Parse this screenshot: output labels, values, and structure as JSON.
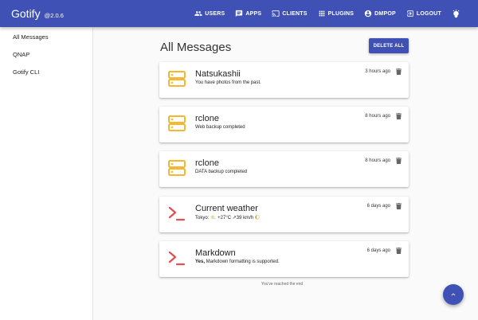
{
  "app": {
    "name": "Gotify",
    "version": "@2.0.6"
  },
  "nav": {
    "users": "USERS",
    "apps": "APPS",
    "clients": "CLIENTS",
    "plugins": "PLUGINS",
    "user": "DMPOP",
    "logout": "LOGOUT"
  },
  "sidebar": {
    "items": [
      {
        "label": "All Messages"
      },
      {
        "label": "QNAP"
      },
      {
        "label": "Gotify CLI"
      }
    ]
  },
  "main": {
    "title": "All Messages",
    "delete_all_label": "DELETE ALL",
    "end_note": "You've reached the end"
  },
  "messages": [
    {
      "icon": "server-icon",
      "title": "Natsukashii",
      "message": "You have photos from the past.",
      "time": "3 hours ago"
    },
    {
      "icon": "server-icon",
      "title": "rclone",
      "message": "Web backup completed",
      "time": "8 hours ago"
    },
    {
      "icon": "server-icon",
      "title": "rclone",
      "message": "DATA backup completed",
      "time": "8 hours ago"
    },
    {
      "icon": "terminal-icon",
      "title": "Current weather",
      "message_parts": {
        "prefix": "Tokyo: ",
        "weather_symbol": "⛅",
        "details": " +27°C ↗39 km/h ",
        "moon_symbol": "🌔"
      },
      "time": "6 days ago"
    },
    {
      "icon": "terminal-icon",
      "title": "Markdown",
      "message_parts": {
        "bold": "Yes,",
        "rest": " Markdown formatting is supported."
      },
      "time": "6 days ago"
    }
  ],
  "colors": {
    "primary": "#3f51b5",
    "server_icon": "#f5b731",
    "terminal_icon": "#e05050"
  }
}
